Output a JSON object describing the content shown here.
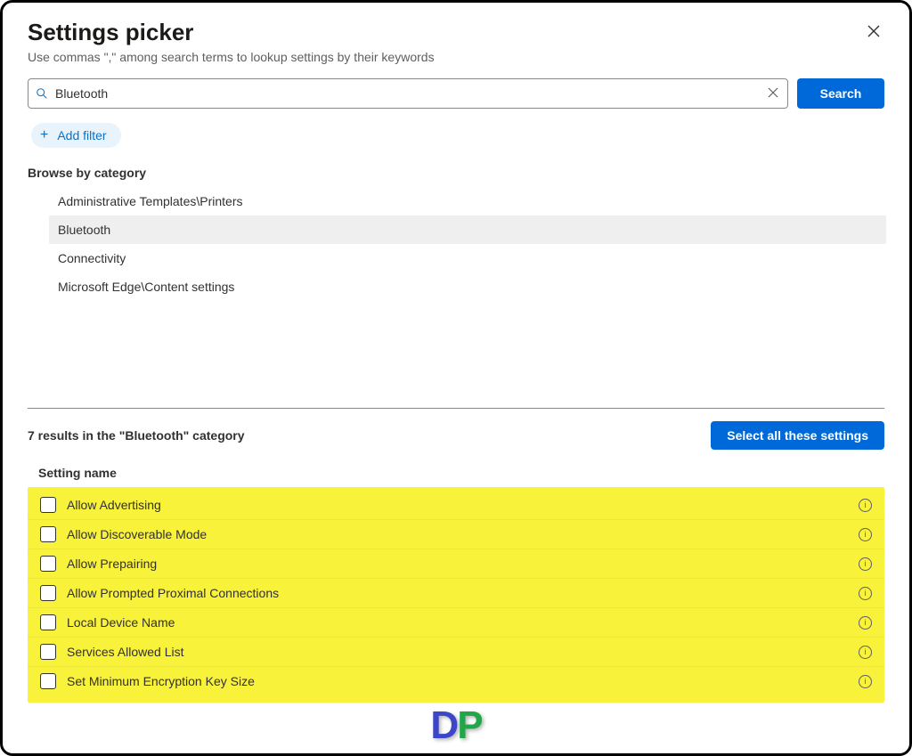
{
  "header": {
    "title": "Settings picker",
    "subtitle": "Use commas \",\" among search terms to lookup settings by their keywords"
  },
  "search": {
    "value": "Bluetooth",
    "button": "Search"
  },
  "filter": {
    "add_label": "Add filter"
  },
  "browse": {
    "label": "Browse by category",
    "items": [
      {
        "label": "Administrative Templates\\Printers",
        "selected": false
      },
      {
        "label": "Bluetooth",
        "selected": true
      },
      {
        "label": "Connectivity",
        "selected": false
      },
      {
        "label": "Microsoft Edge\\Content settings",
        "selected": false
      }
    ]
  },
  "results": {
    "summary": "7 results in the \"Bluetooth\" category",
    "select_all": "Select all these settings",
    "column_header": "Setting name",
    "settings": [
      {
        "label": "Allow Advertising"
      },
      {
        "label": "Allow Discoverable Mode"
      },
      {
        "label": "Allow Prepairing"
      },
      {
        "label": "Allow Prompted Proximal Connections"
      },
      {
        "label": "Local Device Name"
      },
      {
        "label": "Services Allowed List"
      },
      {
        "label": "Set Minimum Encryption Key Size"
      }
    ]
  }
}
